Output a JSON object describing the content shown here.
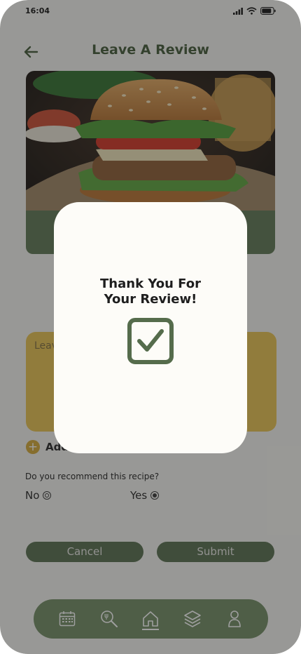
{
  "status_bar": {
    "time": "16:04"
  },
  "header": {
    "title": "Leave A Review"
  },
  "review": {
    "placeholder": "Leave"
  },
  "add_photo": {
    "label": "Add",
    "plus": "+"
  },
  "recommend": {
    "question": "Do you recommend this recipe?",
    "options": [
      {
        "label": "No",
        "selected": false
      },
      {
        "label": "Yes",
        "selected": true
      }
    ]
  },
  "actions": {
    "cancel": "Cancel",
    "submit": "Submit"
  },
  "nav": {
    "items": [
      {
        "icon": "calendar-icon",
        "active": false
      },
      {
        "icon": "recipe-search-icon",
        "active": false
      },
      {
        "icon": "home-icon",
        "active": true
      },
      {
        "icon": "layers-icon",
        "active": false
      },
      {
        "icon": "profile-icon",
        "active": false
      }
    ]
  },
  "modal": {
    "line1": "Thank You For",
    "line2": "Your Review!"
  },
  "colors": {
    "brand_green": "#3e5733",
    "accent_yellow": "#e8c14d",
    "overlay": "rgba(40,40,40,0.45)",
    "modal_bg": "#fdfcf8"
  }
}
